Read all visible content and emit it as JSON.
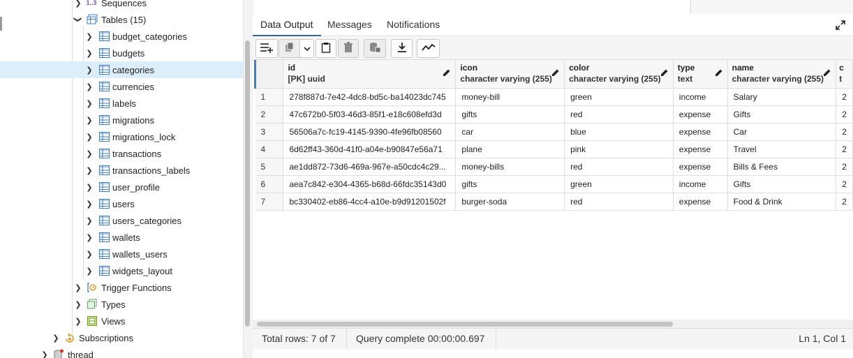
{
  "tree": {
    "sequences_label": "Sequences",
    "sequences_icon": "1..3",
    "tables_label": "Tables (15)",
    "tables": [
      "budget_categories",
      "budgets",
      "categories",
      "currencies",
      "labels",
      "migrations",
      "migrations_lock",
      "transactions",
      "transactions_labels",
      "user_profile",
      "users",
      "users_categories",
      "wallets",
      "wallets_users",
      "widgets_layout"
    ],
    "selected_table": "categories",
    "trigger_functions_label": "Trigger Functions",
    "types_label": "Types",
    "views_label": "Views",
    "subscriptions_label": "Subscriptions",
    "thread_label": "thread"
  },
  "tabs": [
    {
      "label": "Data Output",
      "active": true
    },
    {
      "label": "Messages",
      "active": false
    },
    {
      "label": "Notifications",
      "active": false
    }
  ],
  "toolbar": {
    "buttons": [
      "add-row-icon",
      "copy-icon",
      "chevron-down-icon",
      "paste-icon",
      "delete-icon",
      "save-data-icon",
      "download-icon",
      "graph-icon"
    ]
  },
  "grid": {
    "columns": [
      {
        "name": "id",
        "type": "[PK] uuid"
      },
      {
        "name": "icon",
        "type": "character varying (255)"
      },
      {
        "name": "color",
        "type": "character varying (255)"
      },
      {
        "name": "type",
        "type": "text"
      },
      {
        "name": "name",
        "type": "character varying (255)"
      },
      {
        "name": "c",
        "type": "t"
      }
    ],
    "rows": [
      {
        "num": "1",
        "id": "278f887d-7e42-4dc8-bd5c-ba14023dc745",
        "icon": "money-bill",
        "color": "green",
        "type": "income",
        "name": "Salary",
        "extra": "2"
      },
      {
        "num": "2",
        "id": "47c672b0-5f03-46d3-85f1-e18c608efd3d",
        "icon": "gifts",
        "color": "red",
        "type": "expense",
        "name": "Gifts",
        "extra": "2"
      },
      {
        "num": "3",
        "id": "56506a7c-fc19-4145-9390-4fe96fb08560",
        "icon": "car",
        "color": "blue",
        "type": "expense",
        "name": "Car",
        "extra": "2"
      },
      {
        "num": "4",
        "id": "6d62ff43-360d-41f0-a04e-b90847e56a71",
        "icon": "plane",
        "color": "pink",
        "type": "expense",
        "name": "Travel",
        "extra": "2"
      },
      {
        "num": "5",
        "id": "ae1dd872-73d6-469a-967e-a50cdc4c29...",
        "icon": "money-bills",
        "color": "red",
        "type": "expense",
        "name": "Bills & Fees",
        "extra": "2"
      },
      {
        "num": "6",
        "id": "aea7c842-e304-4365-b68d-66fdc35143d0",
        "icon": "gifts",
        "color": "green",
        "type": "income",
        "name": "Gifts",
        "extra": "2"
      },
      {
        "num": "7",
        "id": "bc330402-eb86-4cc4-a10e-b9d91201502f",
        "icon": "burger-soda",
        "color": "red",
        "type": "expense",
        "name": "Food & Drink",
        "extra": "2"
      }
    ]
  },
  "status": {
    "total_rows": "Total rows: 7 of 7",
    "query": "Query complete 00:00:00.697",
    "cursor": "Ln 1, Col 1"
  },
  "colors": {
    "selected_row": "#dbeefa",
    "tab_active": "#326690",
    "table_icon": "#3b7fc4"
  }
}
